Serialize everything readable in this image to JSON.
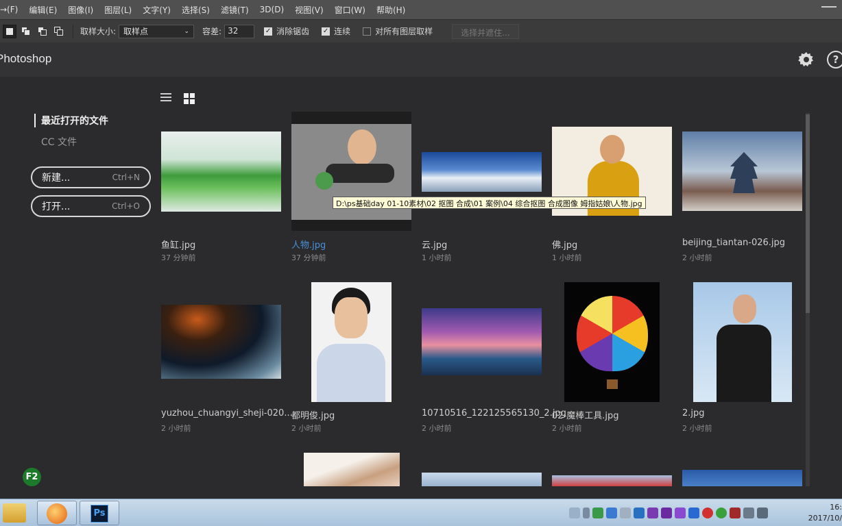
{
  "menu": [
    "→(F)",
    "编辑(E)",
    "图像(I)",
    "图层(L)",
    "文字(Y)",
    "选择(S)",
    "滤镜(T)",
    "3D(D)",
    "视图(V)",
    "窗口(W)",
    "帮助(H)"
  ],
  "options": {
    "sample_size_label": "取样大小:",
    "sample_size_value": "取样点",
    "tolerance_label": "容差:",
    "tolerance_value": "32",
    "antialias_label": "消除锯齿",
    "contiguous_label": "连续",
    "all_layers_label": "对所有图层取样",
    "select_mask_label": "选择并遮住..."
  },
  "header": {
    "brand": "Photoshop"
  },
  "sidebar": {
    "recent_label": "最近打开的文件",
    "cc_label": "CC 文件",
    "new_label": "新建...",
    "new_shortcut": "Ctrl+N",
    "open_label": "打开...",
    "open_shortcut": "Ctrl+O"
  },
  "files": [
    {
      "name": "鱼缸.jpg",
      "time": "37 分钟前"
    },
    {
      "name": "人物.jpg",
      "time": "37 分钟前"
    },
    {
      "name": "云.jpg",
      "time": "1 小时前"
    },
    {
      "name": "佛.jpg",
      "time": "1 小时前"
    },
    {
      "name": "beijing_tiantan-026.jpg",
      "time": "2 小时前"
    },
    {
      "name": "yuzhou_chuangyi_sheji-020....",
      "time": "2 小时前"
    },
    {
      "name": "都明俊.jpg",
      "time": "2 小时前"
    },
    {
      "name": "10710516_122125565130_2.jpg",
      "time": "2 小时前"
    },
    {
      "name": "02-魔棒工具.jpg",
      "time": "2 小时前"
    },
    {
      "name": "2.jpg",
      "time": "2 小时前"
    }
  ],
  "tooltip": "D:\\ps基础day 01-10素材\\02 抠图 合成\\01 案例\\04 综合抠图 合成图像 姆指姑娘\\人物.jpg",
  "badge": "F2",
  "clock": {
    "time": "16:",
    "date": "2017/10/"
  },
  "colors": {
    "accent_link": "#4a90d9",
    "background": "#2b2b2d"
  }
}
